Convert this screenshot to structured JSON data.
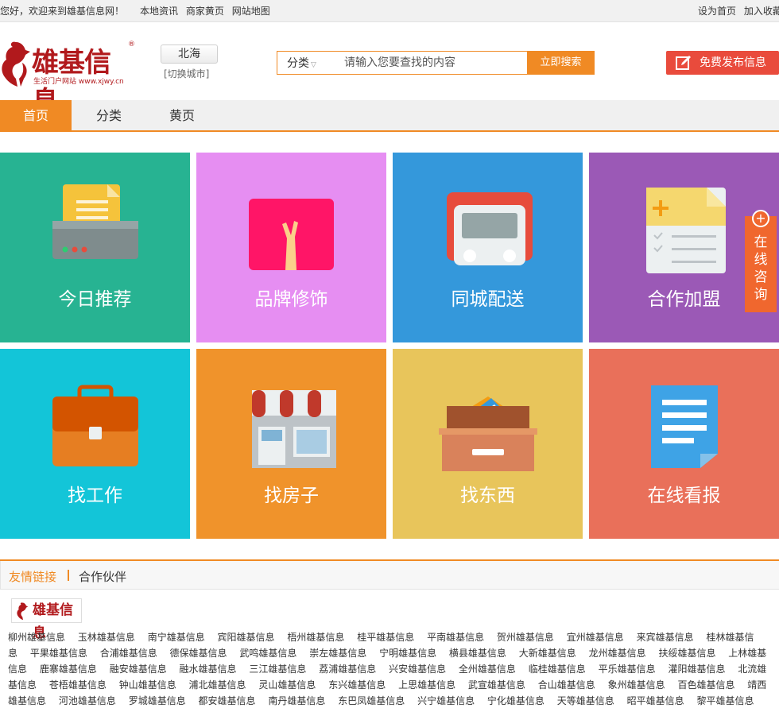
{
  "topbar": {
    "welcome": "您好，欢迎来到雄基信息网！",
    "links": [
      "本地资讯",
      "商家黄页",
      "网站地图"
    ],
    "right": [
      "设为首页",
      "加入收藏"
    ]
  },
  "header": {
    "brand": "雄基信息",
    "reg_mark": "®",
    "tagline": "生活门户网站 www.xjwy.cn",
    "city": "北海",
    "switch_city": "[切换城市]",
    "search": {
      "category": "分类",
      "placeholder": "请输入您要查找的内容",
      "button": "立即搜索"
    },
    "publish_button": "免费发布信息"
  },
  "nav": {
    "tabs": [
      {
        "label": "首页",
        "active": true
      },
      {
        "label": "分类",
        "active": false
      },
      {
        "label": "黄页",
        "active": false
      }
    ]
  },
  "tiles": [
    {
      "label": "今日推荐",
      "color": "#27b392",
      "icon": "printer-icon"
    },
    {
      "label": "品牌修饰",
      "color": "#e68ef2",
      "icon": "brand-icon"
    },
    {
      "label": "同城配送",
      "color": "#3498db",
      "icon": "truck-icon"
    },
    {
      "label": "合作加盟",
      "color": "#9b59b6",
      "icon": "document-add-icon"
    },
    {
      "label": "找工作",
      "color": "#13c5d8",
      "icon": "briefcase-icon"
    },
    {
      "label": "找房子",
      "color": "#f0932b",
      "icon": "shop-icon"
    },
    {
      "label": "找东西",
      "color": "#e8c55b",
      "icon": "box-icon"
    },
    {
      "label": "在线看报",
      "color": "#e9705a",
      "icon": "newspaper-icon"
    }
  ],
  "consult": {
    "label": "在线咨询"
  },
  "friend_links": {
    "title": "友情链接",
    "subtitle": "合作伙伴",
    "logo_text": "雄基信息",
    "items": [
      "柳州雄基信息",
      "玉林雄基信息",
      "南宁雄基信息",
      "宾阳雄基信息",
      "梧州雄基信息",
      "桂平雄基信息",
      "平南雄基信息",
      "贺州雄基信息",
      "宜州雄基信息",
      "来宾雄基信息",
      "桂林雄基信息",
      "平果雄基信息",
      "合浦雄基信息",
      "德保雄基信息",
      "武鸣雄基信息",
      "崇左雄基信息",
      "宁明雄基信息",
      "横县雄基信息",
      "大新雄基信息",
      "龙州雄基信息",
      "扶绥雄基信息",
      "上林雄基信息",
      "鹿寨雄基信息",
      "融安雄基信息",
      "融水雄基信息",
      "三江雄基信息",
      "荔浦雄基信息",
      "兴安雄基信息",
      "全州雄基信息",
      "临桂雄基信息",
      "平乐雄基信息",
      "灌阳雄基信息",
      "北流雄基信息",
      "苍梧雄基信息",
      "钟山雄基信息",
      "浦北雄基信息",
      "灵山雄基信息",
      "东兴雄基信息",
      "上思雄基信息",
      "武宣雄基信息",
      "合山雄基信息",
      "象州雄基信息",
      "百色雄基信息",
      "靖西雄基信息",
      "河池雄基信息",
      "罗城雄基信息",
      "都安雄基信息",
      "南丹雄基信息",
      "东巴凤雄基信息",
      "兴宁雄基信息",
      "宁化雄基信息",
      "天等雄基信息",
      "昭平雄基信息",
      "黎平雄基信息"
    ]
  }
}
